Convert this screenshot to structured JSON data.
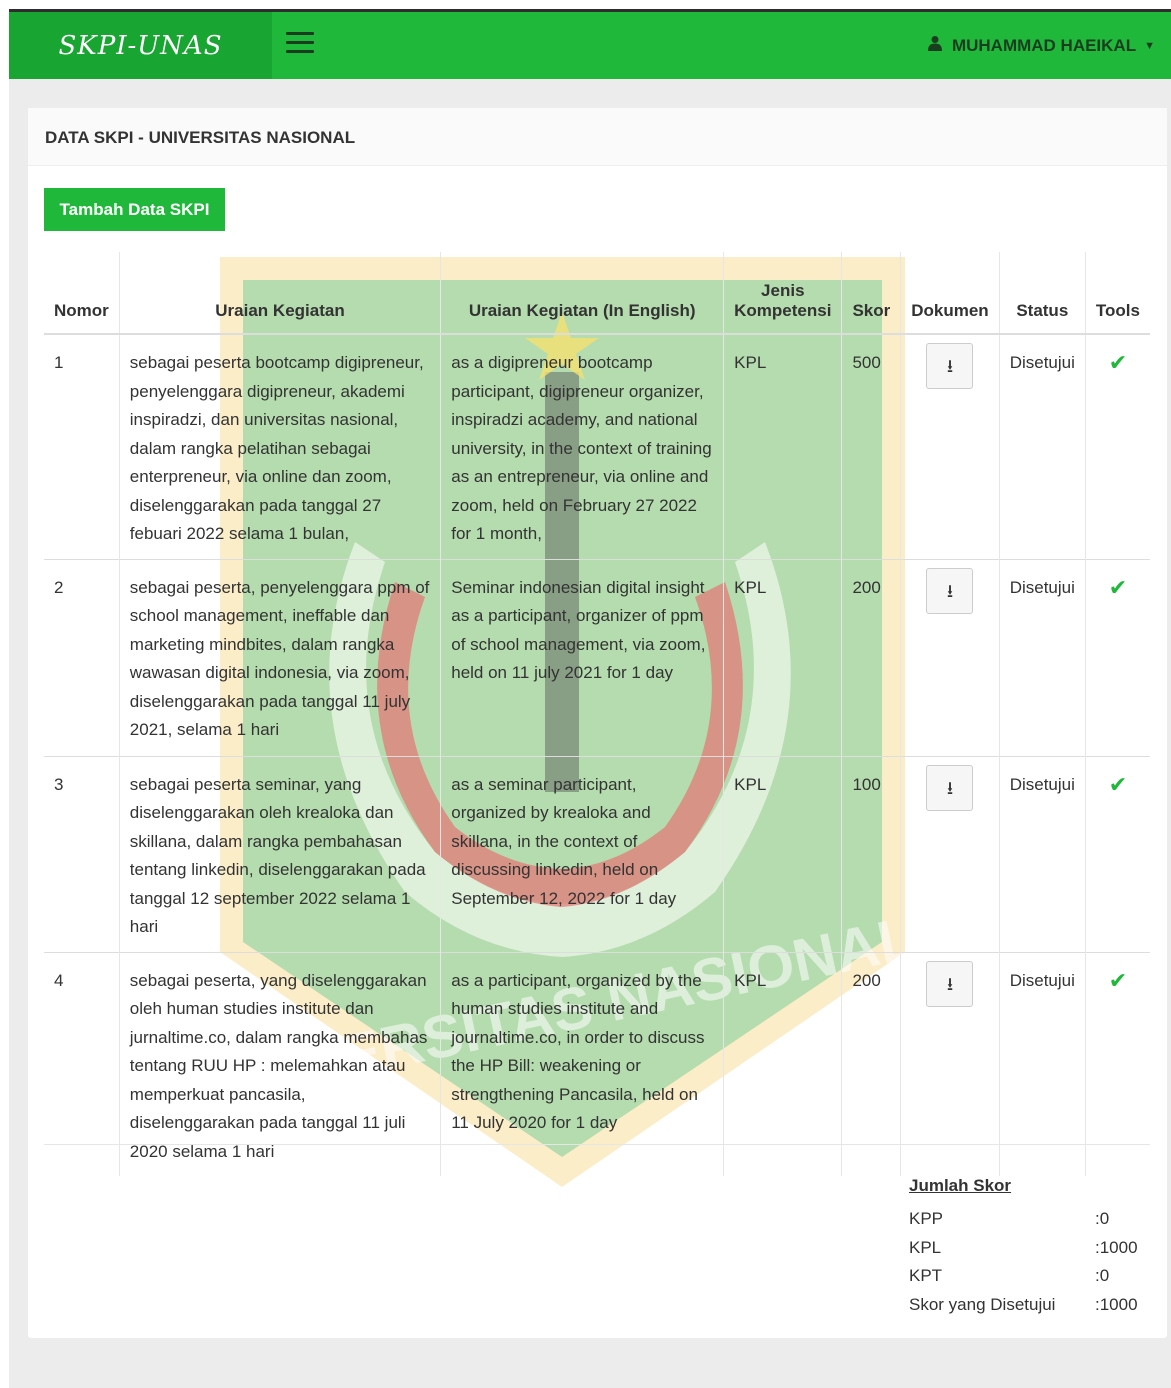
{
  "navbar": {
    "brand": "SKPI-UNAS",
    "user_name": "MUHAMMAD HAEIKAL",
    "colors": {
      "primary": "#1fb83a",
      "brand_bg": "#19a531"
    }
  },
  "panel": {
    "heading": "DATA SKPI - UNIVERSITAS NASIONAL",
    "add_button": "Tambah Data SKPI"
  },
  "table": {
    "headers": {
      "nomor": "Nomor",
      "uraian": "Uraian Kegiatan",
      "uraian_en": "Uraian Kegiatan (In English)",
      "jenis": "Jenis Kompetensi",
      "skor": "Skor",
      "dokumen": "Dokumen",
      "status": "Status",
      "tools": "Tools"
    },
    "rows": [
      {
        "nomor": "1",
        "uraian": "sebagai peserta bootcamp digipreneur, penyelenggara digipreneur, akademi inspiradzi, dan universitas nasional, dalam rangka pelatihan sebagai enterpreneur, via online dan zoom, diselenggarakan pada tanggal 27 febuari 2022 selama 1 bulan,",
        "uraian_en": "as a digipreneur bootcamp participant, digipreneur organizer, inspiradzi academy, and national university, in the context of training as an entrepreneur, via online and zoom, held on February 27 2022 for 1 month,",
        "jenis": "KPL",
        "skor": "500",
        "status": "Disetujui"
      },
      {
        "nomor": "2",
        "uraian": "sebagai peserta, penyelenggara ppm of school management, ineffable dan marketing mindbites, dalam rangka wawasan digital indonesia, via zoom, diselenggarakan pada tanggal 11 july 2021, selama 1 hari",
        "uraian_en": "Seminar indonesian digital insight as a participant, organizer of ppm of school management, via zoom, held on 11 july 2021 for 1 day",
        "jenis": "KPL",
        "skor": "200",
        "status": "Disetujui"
      },
      {
        "nomor": "3",
        "uraian": "sebagai peserta seminar, yang diselenggarakan oleh krealoka dan skillana, dalam rangka pembahasan tentang linkedin, diselenggarakan pada tanggal 12 september 2022 selama 1 hari",
        "uraian_en": "as a seminar participant, organized by krealoka and skillana, in the context of discussing linkedin, held on September 12, 2022 for 1 day",
        "jenis": "KPL",
        "skor": "100",
        "status": "Disetujui"
      },
      {
        "nomor": "4",
        "uraian": "sebagai peserta, yang diselenggarakan oleh human studies institute dan jurnaltime.co, dalam rangka membahas tentang RUU HP : melemahkan atau memperkuat pancasila, diselenggarakan pada tanggal 11 juli 2020 selama 1 hari",
        "uraian_en": "as a participant, organized by the human studies institute and journaltime.co, in order to discuss the HP Bill: weakening or strengthening Pancasila, held on 11 July 2020 for 1 day",
        "jenis": "KPL",
        "skor": "200",
        "status": "Disetujui"
      }
    ]
  },
  "summary": {
    "title": "Jumlah Skor",
    "rows": [
      {
        "label": "KPP",
        "value": ":0"
      },
      {
        "label": "KPL",
        "value": ":1000"
      },
      {
        "label": "KPT",
        "value": ":0"
      },
      {
        "label": "Skor yang Disetujui",
        "value": ":1000"
      }
    ]
  },
  "watermark": {
    "text": "UNIVERSITAS NASIONAL"
  },
  "icons": {
    "user": "user-icon",
    "download": "download-icon",
    "check": "check-icon",
    "menu": "hamburger-icon"
  }
}
